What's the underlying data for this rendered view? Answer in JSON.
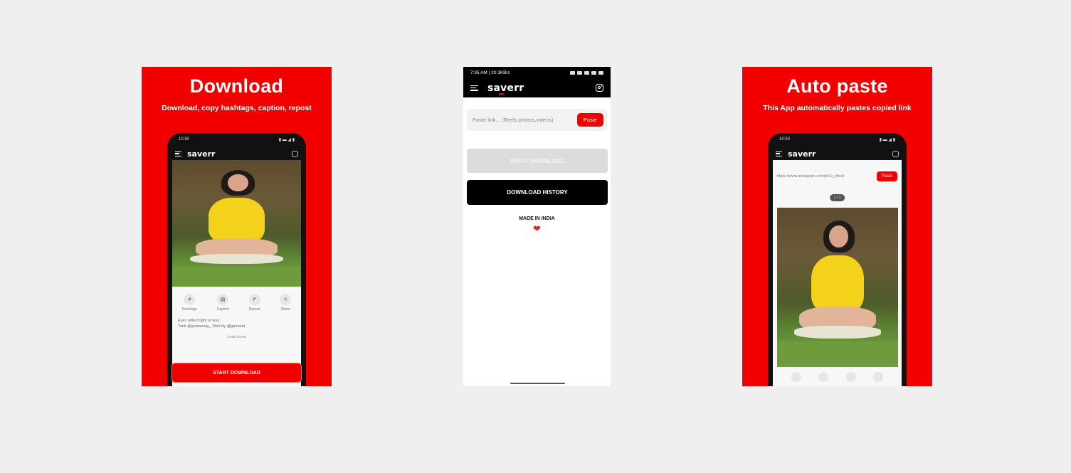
{
  "left_card": {
    "title": "Download",
    "subtitle": "Download, copy hashtags, caption, repost",
    "mock": {
      "time": "10:50",
      "logo": "saverr",
      "actions": [
        {
          "icon": "#",
          "label": "Hashtags"
        },
        {
          "icon": "▤",
          "label": "Caption"
        },
        {
          "icon": "↱",
          "label": "Repost"
        },
        {
          "icon": "<",
          "label": "Share"
        }
      ],
      "caption_line1": "Eyes reflect light of soul",
      "caption_line2": "Tank @goneaway_ Shirt by @garment",
      "load_more": "Load more",
      "start_download": "START DOWNLOAD"
    }
  },
  "center_phone": {
    "status": {
      "time": "7:35 AM | 20.3KB/s"
    },
    "app_logo": "saverr",
    "paste_placeholder": "Paste link... (Reels,photos,videos)",
    "paste_button": "Paste",
    "start_download": "START DOWNLOAD",
    "download_history": "DOWNLOAD HISTORY",
    "made_in": "MADE IN INDIA",
    "heart": "❤"
  },
  "right_card": {
    "title": "Auto paste",
    "subtitle": "This App automatically pastes copied link",
    "mock": {
      "time": "10:50",
      "logo": "saverr",
      "url": "https://www.instagram.com/p/Cc_dfsdv",
      "paste": "Paste",
      "counter": "1 / 1"
    }
  },
  "colors": {
    "brand_red": "#f20000",
    "background": "#efefef",
    "history_button": "#000000",
    "start_button_disabled": "#dcdcdc"
  }
}
